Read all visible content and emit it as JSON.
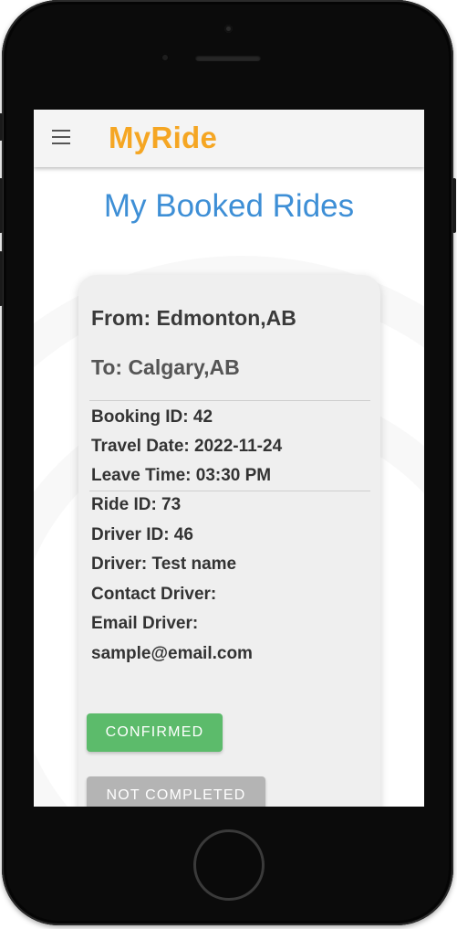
{
  "app": {
    "brand": "MyRide",
    "brand_color": "#f5a623",
    "menu_icon": "hamburger-menu-icon"
  },
  "page": {
    "title": "My Booked Rides",
    "title_color": "#3e8fd6"
  },
  "booking": {
    "from": "From: Edmonton,AB",
    "to": "To: Calgary,AB",
    "booking_id": "Booking ID: 42",
    "travel_date": "Travel Date: 2022-11-24",
    "leave_time": "Leave Time: 03:30 PM",
    "ride_id": "Ride ID: 73",
    "driver_id": "Driver ID: 46",
    "driver": "Driver: Test name",
    "contact_driver": "Contact Driver:",
    "email_driver": "Email Driver:",
    "email": "sample@email.com",
    "status_confirmed": "CONFIRMED",
    "status_completion": "NOT COMPLETED",
    "confirmed_color": "#5cbb6b",
    "not_completed_color": "#b4b4b4"
  }
}
